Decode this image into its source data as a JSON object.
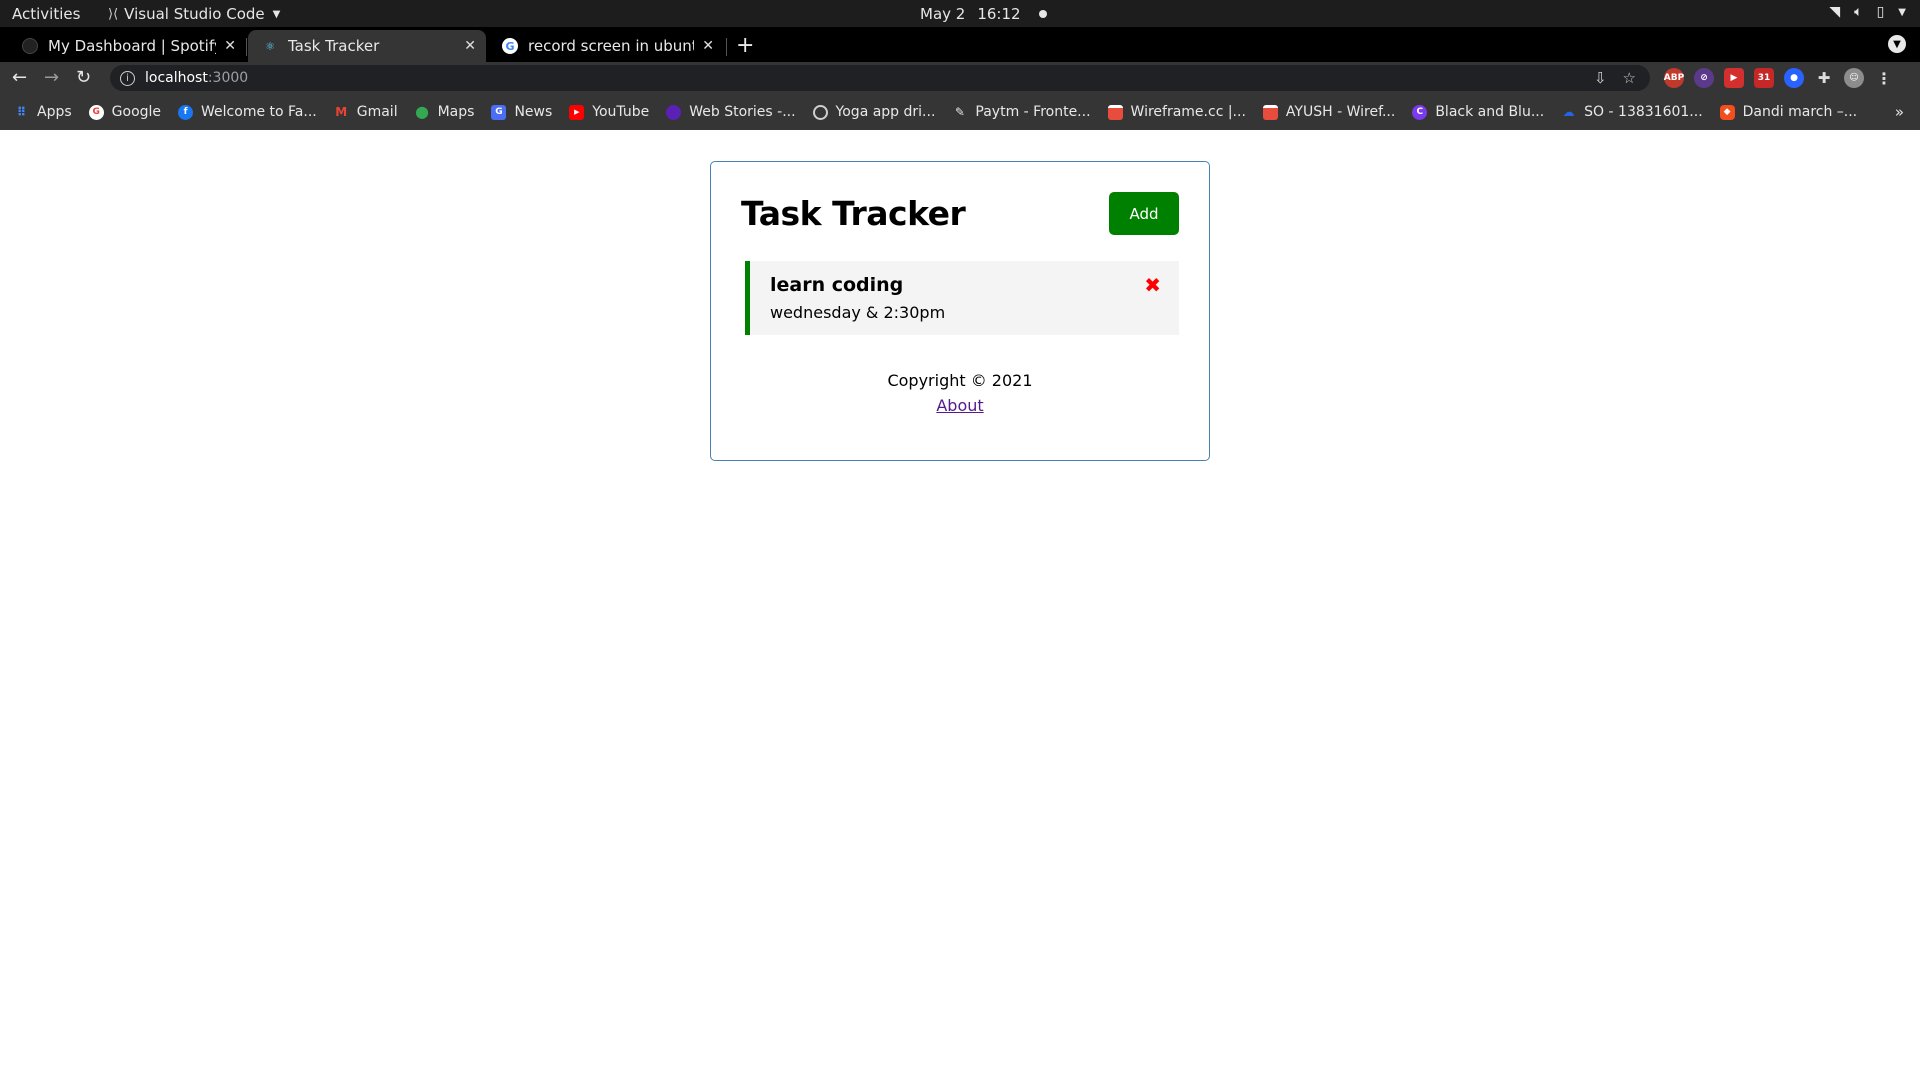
{
  "system_bar": {
    "activities": "Activities",
    "app_name": "Visual Studio Code",
    "date": "May 2",
    "time": "16:12"
  },
  "browser": {
    "tabs": [
      {
        "title": "My Dashboard | Spotify fo",
        "active": false
      },
      {
        "title": "Task Tracker",
        "active": true
      },
      {
        "title": "record screen in ubuntu 2",
        "active": false
      }
    ],
    "url_host": "localhost",
    "url_port": ":3000",
    "bookmarks": [
      {
        "label": "Apps",
        "icon": "apps-grid-icon",
        "color": "#4285f4"
      },
      {
        "label": "Google",
        "icon": "google-icon",
        "color": "#ffffff"
      },
      {
        "label": "Welcome to Fa...",
        "icon": "facebook-icon",
        "color": "#1877f2"
      },
      {
        "label": "Gmail",
        "icon": "gmail-icon",
        "color": "#ea4335"
      },
      {
        "label": "Maps",
        "icon": "maps-icon",
        "color": "#34a853"
      },
      {
        "label": "News",
        "icon": "news-icon",
        "color": "#4c6ef5"
      },
      {
        "label": "YouTube",
        "icon": "youtube-icon",
        "color": "#ff0000"
      },
      {
        "label": "Web Stories -...",
        "icon": "web-stories-icon",
        "color": "#5b21b6"
      },
      {
        "label": "Yoga app   dri...",
        "icon": "drive-icon",
        "color": "#cfcfcf"
      },
      {
        "label": "Paytm - Fronte...",
        "icon": "pen-icon",
        "color": "#cfcfcf"
      },
      {
        "label": "Wireframe.cc |...",
        "icon": "wireframe-icon",
        "color": "#e74c3c"
      },
      {
        "label": "AYUSH - Wiref...",
        "icon": "wireframe-icon",
        "color": "#e74c3c"
      },
      {
        "label": "Black and Blu...",
        "icon": "canva-icon",
        "color": "#7c3aed"
      },
      {
        "label": "SO - 13831601...",
        "icon": "cloud-icon",
        "color": "#2563eb"
      },
      {
        "label": "Dandi march –...",
        "icon": "figma-icon",
        "color": "#f24e1e"
      }
    ]
  },
  "app": {
    "title": "Task Tracker",
    "add_label": "Add",
    "tasks": [
      {
        "text": "learn coding",
        "day": "wednesday & 2:30pm"
      }
    ],
    "footer_copyright": "Copyright © 2021",
    "footer_about": "About"
  }
}
